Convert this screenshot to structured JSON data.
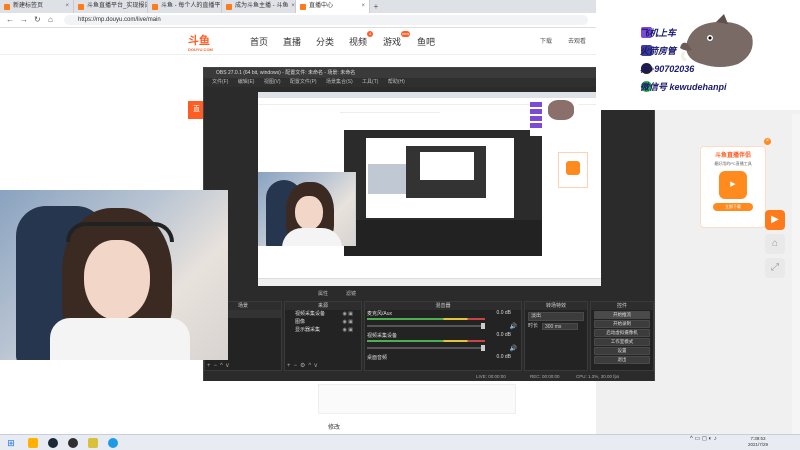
{
  "browser": {
    "tabs": [
      {
        "label": "新建标签页"
      },
      {
        "label": "斗鱼直播平台_实现报告"
      },
      {
        "label": "斗鱼 - 每个人的直播平台"
      },
      {
        "label": "成为斗鱼主播 - 斗鱼"
      },
      {
        "label": "直播中心"
      }
    ],
    "url": "https://mp.douyu.com/live/main"
  },
  "douyu": {
    "logo": "斗鱼",
    "logo_sub": "DOUYU.COM",
    "nav": [
      "首页",
      "直播",
      "分类",
      "视频",
      "游戏",
      "鱼吧"
    ],
    "nav_badge_video": "4",
    "nav_badge_game": "new",
    "header_right": [
      "下载",
      "去观看"
    ],
    "footer_link": "修改",
    "promo_title": "斗鱼直播伴侣",
    "promo_desc": "最好用的PC直播工具",
    "promo_btn": "立即下载",
    "orange_tab": "直"
  },
  "obs": {
    "title": "OBS 27.0.1 (64 bit, windows) - 配置文件: 未命名 - 场景: 未命名",
    "menu": [
      "文件(F)",
      "编辑(E)",
      "视图(V)",
      "配置文件(P)",
      "场景集合(S)",
      "工具(T)",
      "帮助(H)"
    ],
    "scene_bar": [
      "属性",
      "滤镜"
    ],
    "docks": {
      "scenes_title": "场景",
      "sources_title": "来源",
      "mixer_title": "混音器",
      "transitions_title": "转场特效",
      "controls_title": "控件"
    },
    "sources": [
      "视频采集设备",
      "图像",
      "显示器采集"
    ],
    "mixer": [
      {
        "name": "麦克风/Aux",
        "db": "0.0 dB"
      },
      {
        "name": "视频采集设备",
        "db": "0.0 dB"
      },
      {
        "name": "桌面音频",
        "db": "0.0 dB"
      }
    ],
    "transitions": {
      "type": "淡出",
      "duration_label": "时长",
      "duration": "300 ms"
    },
    "controls": [
      "开始推流",
      "开始录制",
      "启动虚拟摄像机",
      "工作室模式",
      "设置",
      "退出"
    ],
    "status": {
      "live": "LIVE: 00:00:00",
      "rec": "REC: 00:00:00",
      "cpu": "CPU: 1.3%, 30.00 fps"
    }
  },
  "overlay": {
    "lines": [
      "飞机上车",
      "火箭房管",
      "群+90702036",
      "微信号 kewudehanpi"
    ],
    "colors": {
      "plane": "#7b4ad6",
      "rocket": "#3c3c9a",
      "qq": "#222222",
      "wechat": "#2bb24c"
    }
  },
  "taskbar": {
    "time": "7:39:53",
    "date": "2021/7/29"
  },
  "colors": {
    "accent": "#ff5d23",
    "obs_bg": "#2b2b2b"
  }
}
